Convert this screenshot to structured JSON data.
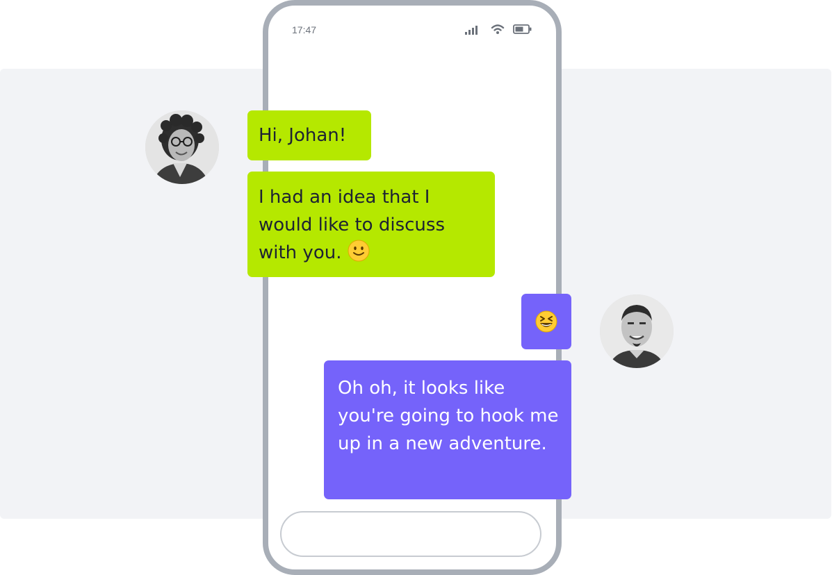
{
  "status_bar": {
    "time": "17:47",
    "signal_icon": "cellular-signal-icon",
    "wifi_icon": "wifi-icon",
    "battery_icon": "battery-icon"
  },
  "contacts": {
    "sender": {
      "avatar_icon": "woman-with-glasses-avatar"
    },
    "recipient": {
      "avatar_icon": "man-with-goatee-avatar"
    }
  },
  "messages": [
    {
      "direction": "incoming",
      "text": "Hi, Johan!"
    },
    {
      "direction": "incoming",
      "text": "I had an idea that I would like to discuss with you.",
      "emoji": "slightly-smiling-face-emoji"
    },
    {
      "direction": "outgoing",
      "emoji": "grinning-squinting-face-emoji"
    },
    {
      "direction": "outgoing",
      "text": "Oh oh, it looks like you're going to hook me up in a new adventure."
    }
  ],
  "compose": {
    "placeholder": ""
  },
  "colors": {
    "incoming_bubble": "#b5e800",
    "outgoing_bubble": "#7563fa",
    "phone_frame": "#a8aeb7",
    "backdrop": "#f2f3f6"
  }
}
